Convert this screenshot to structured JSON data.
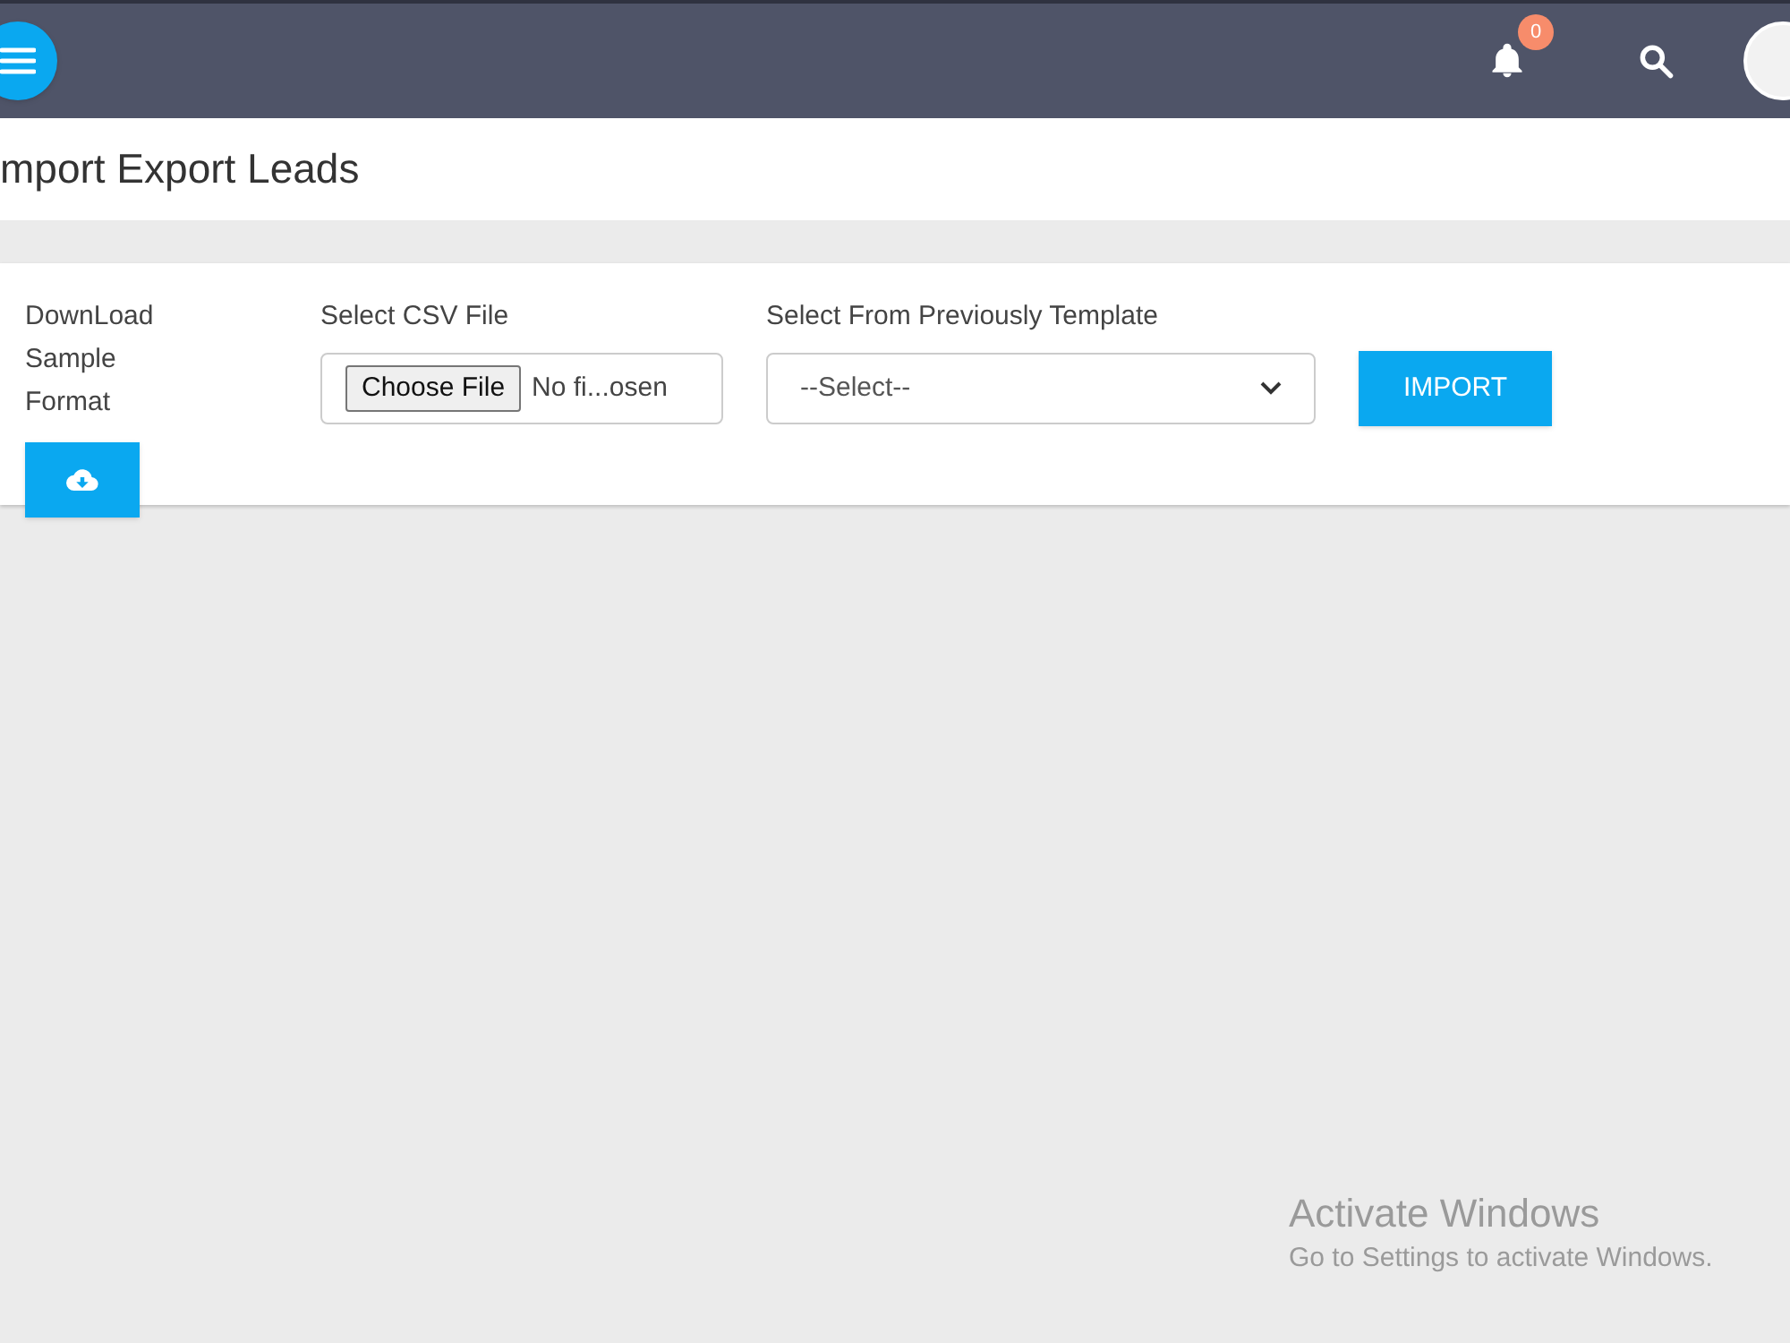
{
  "topbar": {
    "notification_count": "0"
  },
  "page_title": "mport Export Leads",
  "form": {
    "download": {
      "label": "DownLoad Sample Format"
    },
    "csv": {
      "label": "Select CSV File",
      "button": "Choose File",
      "value": "No fi...osen"
    },
    "template": {
      "label": "Select From Previously Template",
      "value": "--Select--"
    },
    "import_button": "IMPORT"
  },
  "os_notice": {
    "title": "Activate Windows",
    "subtitle": "Go to Settings to activate Windows."
  }
}
